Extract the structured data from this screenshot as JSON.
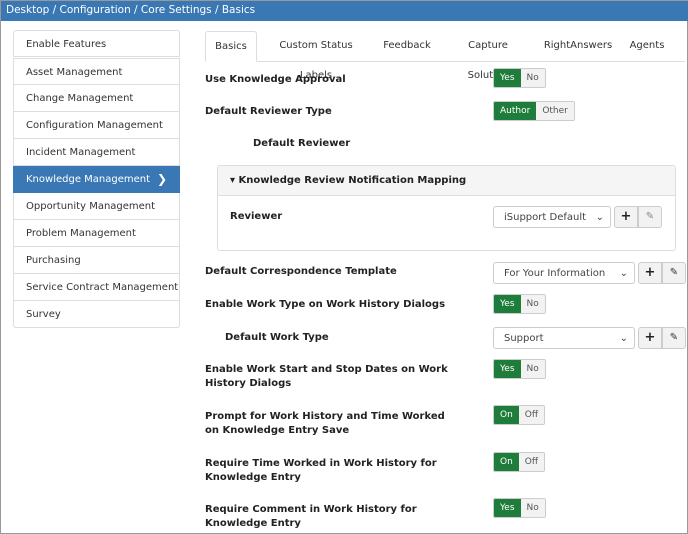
{
  "breadcrumb": "Desktop / Configuration / Core Settings / Basics",
  "sidebar": [
    "Enable Features",
    "Asset Management",
    "Change Management",
    "Configuration Management",
    "Incident Management",
    "Knowledge Management",
    "Opportunity Management",
    "Problem Management",
    "Purchasing",
    "Service Contract Management",
    "Survey"
  ],
  "active_item": "Knowledge Management",
  "tabs": [
    "Basics",
    "Custom Status Labels",
    "Feedback",
    "Capture Solution",
    "RightAnswers",
    "Agents"
  ],
  "rows": {
    "approval": {
      "label": "Use Knowledge Approval",
      "on": "Yes",
      "off": "No",
      "value": "Yes"
    },
    "reviewer_type": {
      "label": "Default Reviewer Type",
      "on": "Author",
      "off": "Other",
      "value": "Author"
    },
    "default_reviewer": "Default Reviewer",
    "panel_title": "Knowledge Review Notification Mapping",
    "reviewer": {
      "label": "Reviewer",
      "value": "iSupport Default"
    },
    "template": {
      "label": "Default Correspondence Template",
      "value": "For Your Information"
    },
    "work_type_enable": {
      "label": "Enable Work Type on Work History Dialogs",
      "on": "Yes",
      "off": "No",
      "value": "Yes"
    },
    "work_type": {
      "label": "Default Work Type",
      "value": "Support"
    },
    "dates": {
      "label": "Enable Work Start and Stop Dates on Work History Dialogs",
      "on": "Yes",
      "off": "No",
      "value": "Yes"
    },
    "prompt": {
      "label": "Prompt for Work History and Time Worked on Knowledge Entry Save",
      "on": "On",
      "off": "Off",
      "value": "On"
    },
    "require_time": {
      "label": "Require Time Worked in Work History for Knowledge Entry",
      "on": "On",
      "off": "Off",
      "value": "On"
    },
    "require_comment": {
      "label": "Require Comment in Work History for Knowledge Entry",
      "on": "Yes",
      "off": "No",
      "value": "Yes"
    }
  },
  "colors": {
    "header": "#3a78b5",
    "toggle_on": "#1e7d3a"
  }
}
